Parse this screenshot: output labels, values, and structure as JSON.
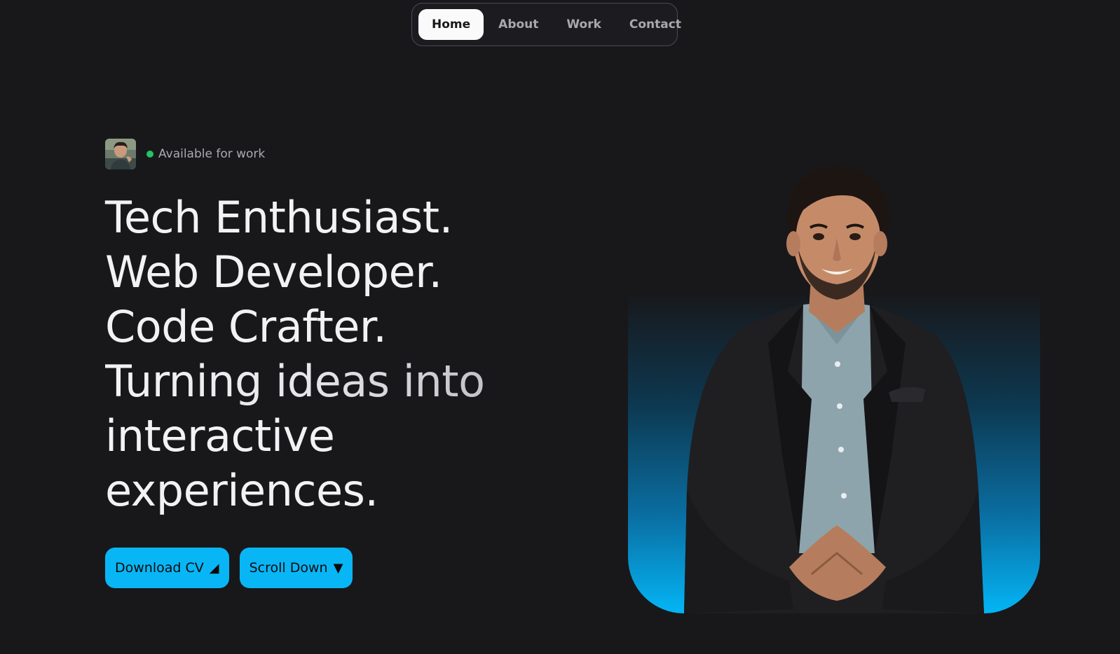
{
  "nav": {
    "items": [
      {
        "label": "Home",
        "active": true
      },
      {
        "label": "About",
        "active": false
      },
      {
        "label": "Work",
        "active": false
      },
      {
        "label": "Contact",
        "active": false
      }
    ]
  },
  "hero": {
    "status_text": "Available for work",
    "status_color": "#22c55e",
    "headline_lines": [
      "Tech Enthusiast.",
      "Web Developer.",
      "Code Crafter.",
      "Turning ideas into",
      "interactive",
      "experiences."
    ],
    "buttons": {
      "download_cv": {
        "label": "Download CV",
        "icon": "◢"
      },
      "scroll_down": {
        "label": "Scroll Down",
        "icon": "▼"
      }
    }
  },
  "colors": {
    "background": "#18181b",
    "accent": "#09b6f5",
    "nav_active_bg": "#fafafa"
  }
}
